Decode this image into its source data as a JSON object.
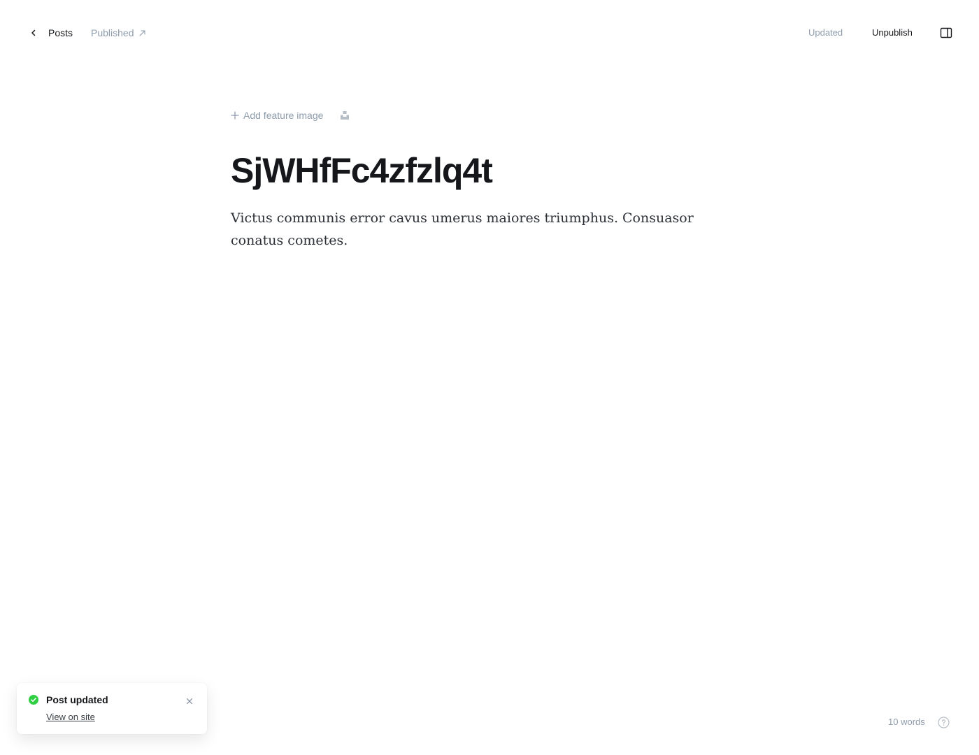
{
  "topbar": {
    "back_label": "Posts",
    "status_label": "Published",
    "updated_label": "Updated",
    "unpublish_label": "Unpublish",
    "icons": {
      "back": "chevron-left-icon",
      "status": "external-arrow-icon",
      "sidebar": "sidebar-toggle-icon"
    }
  },
  "editor": {
    "add_feature_label": "Add feature image",
    "title": "SjWHfFc4zfzlq4t",
    "body": "Victus communis error cavus umerus maiores triumphus. Consuasor conatus cometes.",
    "icons": {
      "add": "plus-icon",
      "unsplash": "unsplash-icon"
    }
  },
  "toast": {
    "title": "Post updated",
    "link_label": "View on site",
    "status_color": "#30cf43",
    "icons": {
      "status": "check-circle-icon",
      "close": "close-icon"
    }
  },
  "footer": {
    "word_count": "10 words",
    "icons": {
      "help": "help-icon"
    }
  },
  "colors": {
    "text": "#15171a",
    "muted": "#8e9cac",
    "success": "#30cf43"
  }
}
